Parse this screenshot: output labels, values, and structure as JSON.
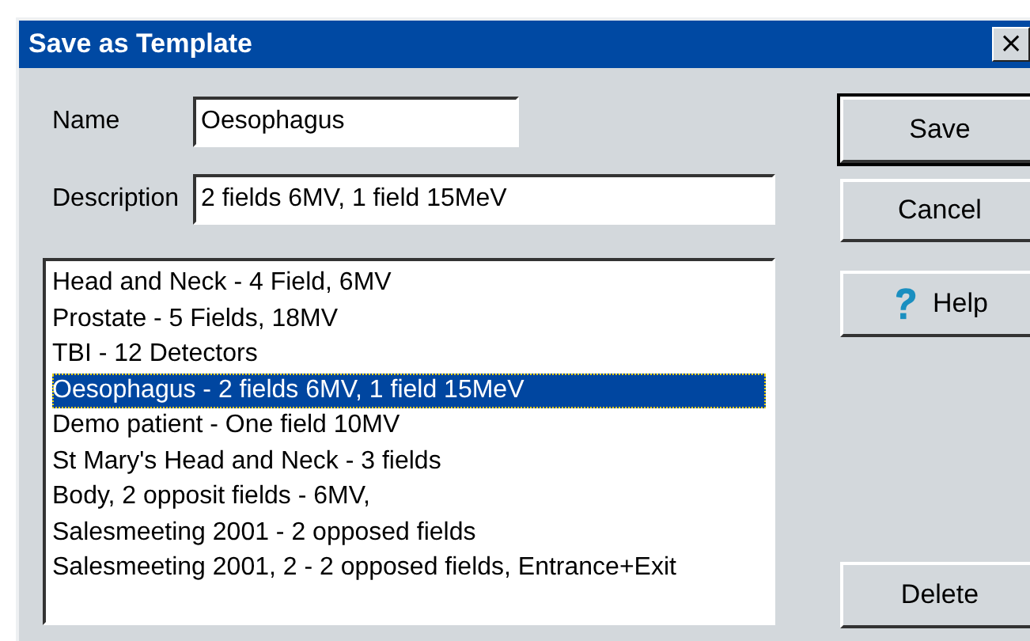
{
  "window": {
    "title": "Save as Template",
    "close": "×"
  },
  "name_field": {
    "label": "Name",
    "value": "Oesophagus"
  },
  "description_field": {
    "label": "Description",
    "value": "2 fields 6MV, 1 field 15MeV"
  },
  "templates": [
    {
      "label": "Head and Neck - 4 Field, 6MV",
      "selected": false
    },
    {
      "label": "Prostate - 5 Fields, 18MV",
      "selected": false
    },
    {
      "label": "TBI - 12 Detectors",
      "selected": false
    },
    {
      "label": "Oesophagus - 2 fields 6MV, 1 field 15MeV",
      "selected": true
    },
    {
      "label": "Demo patient - One field 10MV",
      "selected": false
    },
    {
      "label": "St Mary's Head and Neck - 3 fields",
      "selected": false
    },
    {
      "label": "Body, 2 opposit fields - 6MV,",
      "selected": false
    },
    {
      "label": "Salesmeeting 2001 - 2 opposed fields",
      "selected": false
    },
    {
      "label": "Salesmeeting 2001, 2 - 2 opposed fields, Entrance+Exit",
      "selected": false
    }
  ],
  "buttons": [
    {
      "kind": "save",
      "label": "Save",
      "default": true
    },
    {
      "kind": "cancel",
      "label": "Cancel",
      "default": false
    },
    {
      "kind": "help",
      "label": "Help",
      "default": false
    },
    {
      "kind": "delete",
      "label": "Delete",
      "default": false
    }
  ]
}
